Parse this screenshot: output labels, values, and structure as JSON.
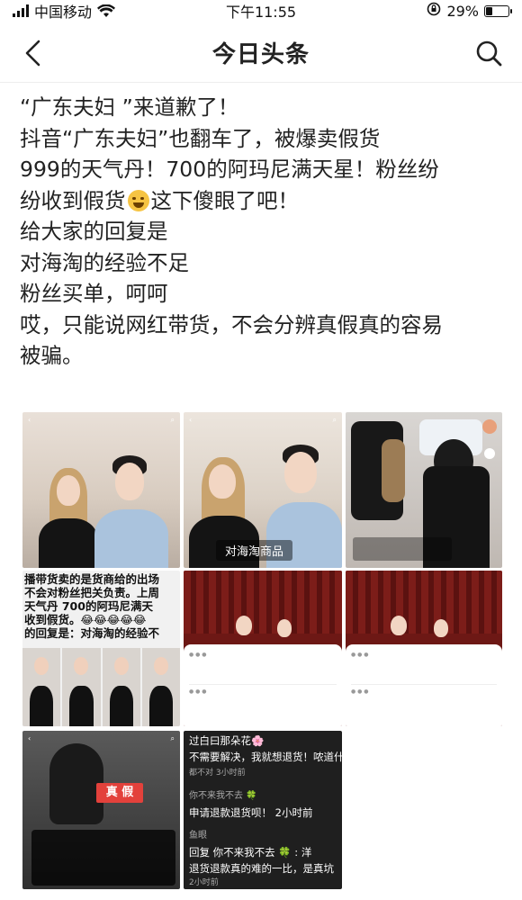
{
  "status_bar": {
    "carrier": "中国移动",
    "time": "下午11:55",
    "battery": "29%",
    "battery_level": 0.29
  },
  "nav": {
    "title": "今日头条"
  },
  "post": {
    "lines": [
      "“广东夫妇 ”来道歉了！",
      "抖音“广东夫妇”也翻车了，被爆卖假货",
      "999的天气丹！700的阿玛尼满天星！粉丝纷",
      "纷收到假货",
      "这下傻眼了吧！",
      "给大家的回复是",
      "对海淘的经验不足",
      "粉丝买单，呵呵",
      "哎，只能说网红带货，不会分辨真假真的容易",
      "被骗。"
    ],
    "emoji": "crying-laughing-face"
  },
  "images": {
    "img2_caption": "对海淘商品",
    "img4_overlay": [
      "播带货卖的是货商给的出场",
      "不会对粉丝把关负责。上周",
      "天气丹 700的阿玛尼满天",
      "收到假货。😂😂😂😂😂",
      "的回复是：对海淘的经验不"
    ],
    "img7_badge": "真 假",
    "img8_lines": [
      "过白曰那朵花🌸",
      "不需要解决，我就想退货！哝道什",
      "都不对 3小时前",
      "你不来我不去 🍀",
      "申请退款退货呗！ 2小时前",
      "鱼眼",
      "回复 你不来我不去 🍀 : 洋",
      "退货退款真的难的一比，是真坑",
      "2小时前"
    ]
  }
}
